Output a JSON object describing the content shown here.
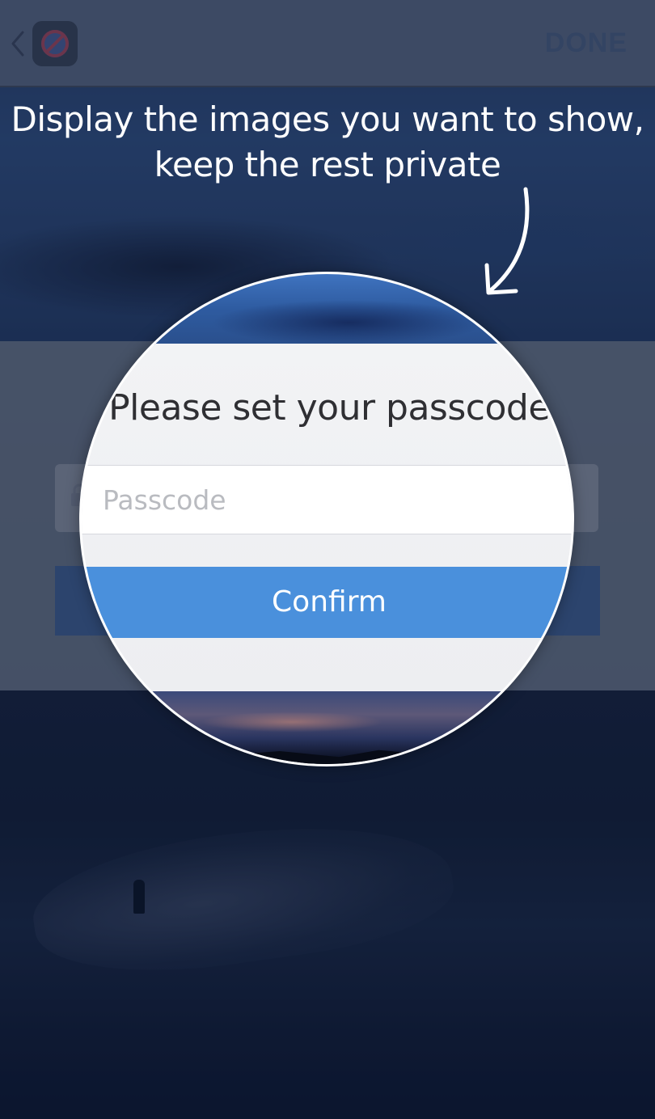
{
  "header": {
    "back_icon": "chevron-left-icon",
    "app_icon": "private-photo-app-icon",
    "done_label": "DONE"
  },
  "headline": {
    "line1": "Display the images you want to show,",
    "line2": "keep the rest private"
  },
  "modal": {
    "title": "Please set your passcode",
    "passcode_placeholder": "Passcode",
    "passcode_value": "",
    "lock_icon": "lock-icon",
    "confirm_label": "Confirm"
  },
  "colors": {
    "confirm_blue": "#4a90dc",
    "panel_gray": "#eeeff2",
    "headline_white": "#ffffff"
  }
}
